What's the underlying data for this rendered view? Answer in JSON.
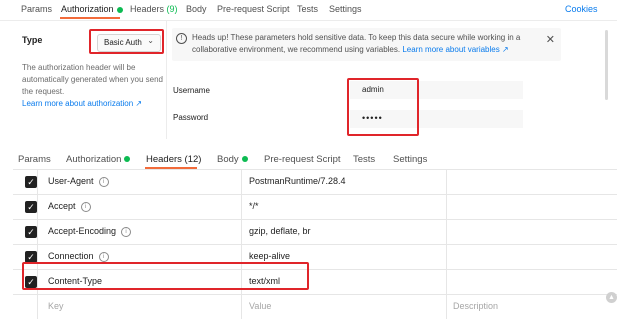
{
  "auth_panel": {
    "tabs": [
      {
        "label": "Params"
      },
      {
        "label": "Authorization"
      },
      {
        "label": "Headers",
        "count": "(9)"
      },
      {
        "label": "Body"
      },
      {
        "label": "Pre-request Script"
      },
      {
        "label": "Tests"
      },
      {
        "label": "Settings"
      }
    ],
    "cookies_label": "Cookies",
    "type_label": "Type",
    "type_value": "Basic Auth",
    "description": "The authorization header will be automatically generated when you send the request.",
    "learn_more_auth": "Learn more about authorization ↗",
    "info_text": "Heads up! These parameters hold sensitive data. To keep this data secure while working in a collaborative environment, we recommend using variables.",
    "info_link": "Learn more about variables ↗",
    "username_label": "Username",
    "username_value": "admin",
    "password_label": "Password",
    "password_value": "•••••"
  },
  "headers_panel": {
    "tabs": [
      {
        "label": "Params"
      },
      {
        "label": "Authorization"
      },
      {
        "label": "Headers (12)"
      },
      {
        "label": "Body"
      },
      {
        "label": "Pre-request Script"
      },
      {
        "label": "Tests"
      },
      {
        "label": "Settings"
      }
    ],
    "rows": [
      {
        "key": "User-Agent",
        "value": "PostmanRuntime/7.28.4"
      },
      {
        "key": "Accept",
        "value": "*/*"
      },
      {
        "key": "Accept-Encoding",
        "value": "gzip, deflate, br"
      },
      {
        "key": "Connection",
        "value": "keep-alive"
      },
      {
        "key": "Content-Type",
        "value": "text/xml"
      }
    ],
    "placeholder_key": "Key",
    "placeholder_value": "Value",
    "placeholder_description": "Description"
  },
  "colors": {
    "accent_orange": "#f26b3a",
    "status_green": "#0cbb52",
    "highlight_red": "#e0252a",
    "link_blue": "#097bed"
  }
}
